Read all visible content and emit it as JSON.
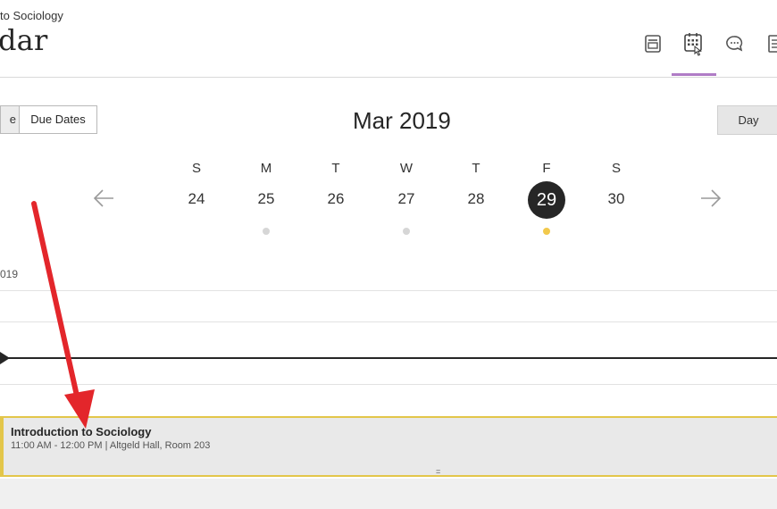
{
  "header": {
    "breadcrumb": "to Sociology",
    "title": "dar",
    "icons": [
      "course-content-icon",
      "calendar-icon",
      "discussions-icon",
      "gradebook-icon"
    ],
    "active_tab_color": "#b07cc6"
  },
  "toolbar": {
    "view_left_label": "e",
    "view_due_dates_label": "Due Dates",
    "month_title": "Mar 2019",
    "day_button_label": "Day"
  },
  "week": {
    "days": [
      {
        "dow": "S",
        "date": "24",
        "has_event": false
      },
      {
        "dow": "M",
        "date": "25",
        "has_event": true
      },
      {
        "dow": "T",
        "date": "26",
        "has_event": false
      },
      {
        "dow": "W",
        "date": "27",
        "has_event": true
      },
      {
        "dow": "T",
        "date": "28",
        "has_event": false
      },
      {
        "dow": "F",
        "date": "29",
        "has_event": true,
        "today": true
      },
      {
        "dow": "S",
        "date": "30",
        "has_event": false
      }
    ],
    "today_dot_color": "#f2c94c",
    "event_dot_color": "#d6d6d6"
  },
  "schedule": {
    "day_label": "019",
    "event": {
      "title": "Introduction to Sociology",
      "meta": "11:00 AM - 12:00 PM | Altgeld Hall, Room 203",
      "border_color": "#e3c64a"
    },
    "grip_glyph": "="
  },
  "annotation": {
    "arrow_color": "#e3262b"
  }
}
